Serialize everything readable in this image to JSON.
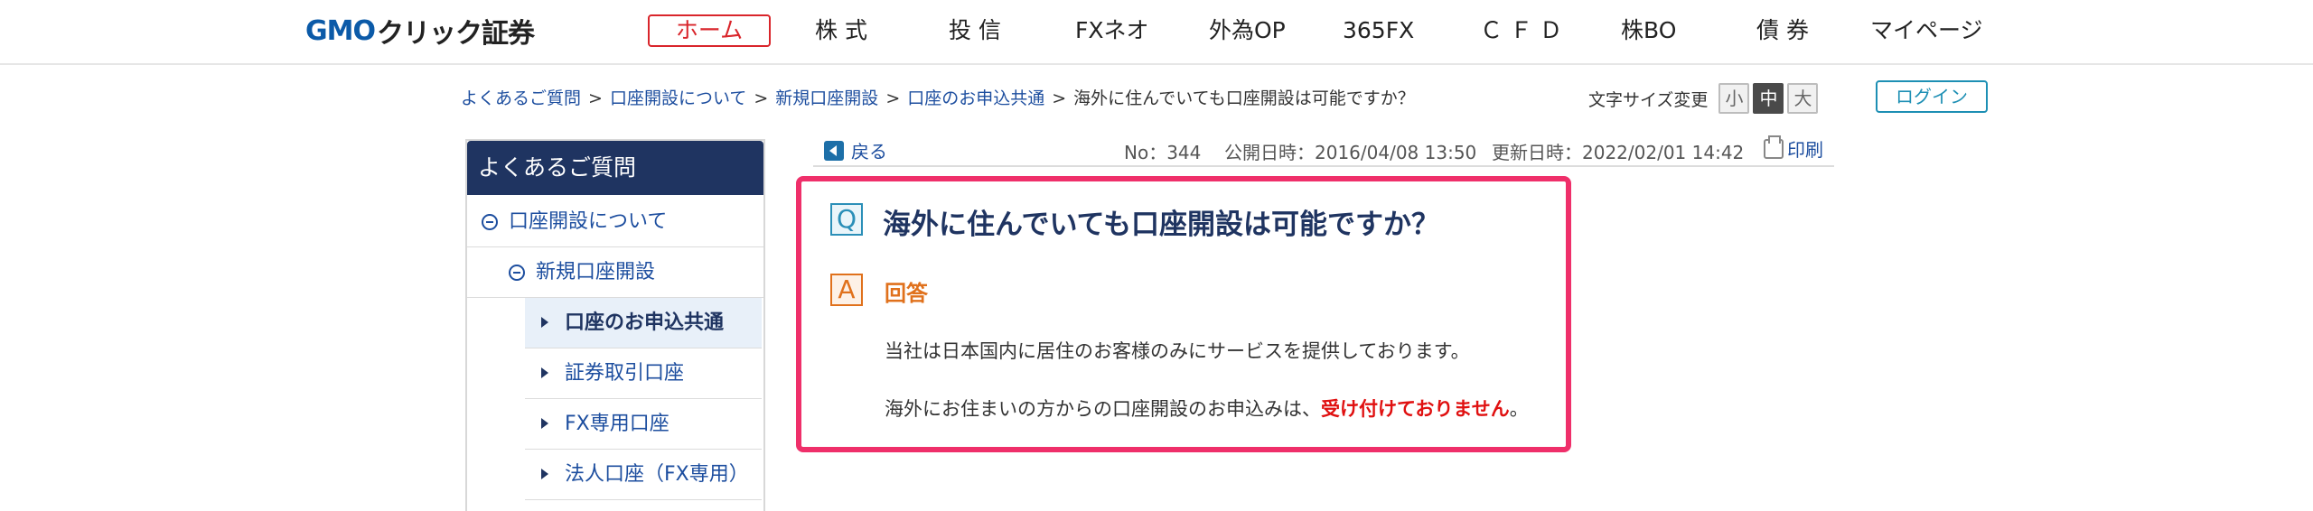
{
  "header": {
    "logo_gmo": "GMO",
    "logo_click": "クリック証券",
    "nav": [
      {
        "label": "ホーム",
        "active": true
      },
      {
        "label": "株 式"
      },
      {
        "label": "投 信"
      },
      {
        "label": "FXネオ"
      },
      {
        "label": "外為OP"
      },
      {
        "label": "365FX"
      },
      {
        "label": "ＣＦＤ"
      },
      {
        "label": "株BO"
      },
      {
        "label": "債 券"
      },
      {
        "label": "マイページ"
      }
    ]
  },
  "breadcrumb": {
    "items": [
      "よくあるご質問",
      "口座開設について",
      "新規口座開設",
      "口座のお申込共通"
    ],
    "current": "海外に住んでいても口座開設は可能ですか？",
    "separator": ">"
  },
  "font_size": {
    "label": "文字サイズ変更",
    "small": "小",
    "medium": "中",
    "large": "大",
    "selected": "中"
  },
  "login_label": "ログイン",
  "sidebar": {
    "title": "よくあるご質問",
    "items": [
      {
        "label": "口座開設について",
        "level": 1,
        "expanded": true
      },
      {
        "label": "新規口座開設",
        "level": 2,
        "expanded": true
      },
      {
        "label": "口座のお申込共通",
        "level": 3,
        "selected": true
      },
      {
        "label": "証券取引口座",
        "level": 3
      },
      {
        "label": "FX専用口座",
        "level": 3
      },
      {
        "label": "法人口座（FX専用）",
        "level": 3
      }
    ]
  },
  "article": {
    "back_label": "戻る",
    "number": "No：344",
    "published": "公開日時：2016/04/08 13:50",
    "updated": "更新日時：2022/02/01 14:42",
    "print_label": "印刷",
    "q_badge": "Q",
    "question": "海外に住んでいても口座開設は可能ですか？",
    "a_badge": "A",
    "answer_heading": "回答",
    "answer_line1": "当社は日本国内に居住のお客様のみにサービスを提供しております。",
    "answer_line2_prefix": "海外にお住まいの方からの口座開設のお申込みは、",
    "answer_line2_emphasis": "受け付けておりません",
    "answer_line2_suffix": "。"
  },
  "colors": {
    "brand_blue": "#0b5aa8",
    "nav_active_red": "#d9252b",
    "sidebar_header": "#1f3461",
    "highlight_border": "#ef2f6a",
    "answer_orange": "#e0711c",
    "emphasis_red": "#e01010"
  }
}
